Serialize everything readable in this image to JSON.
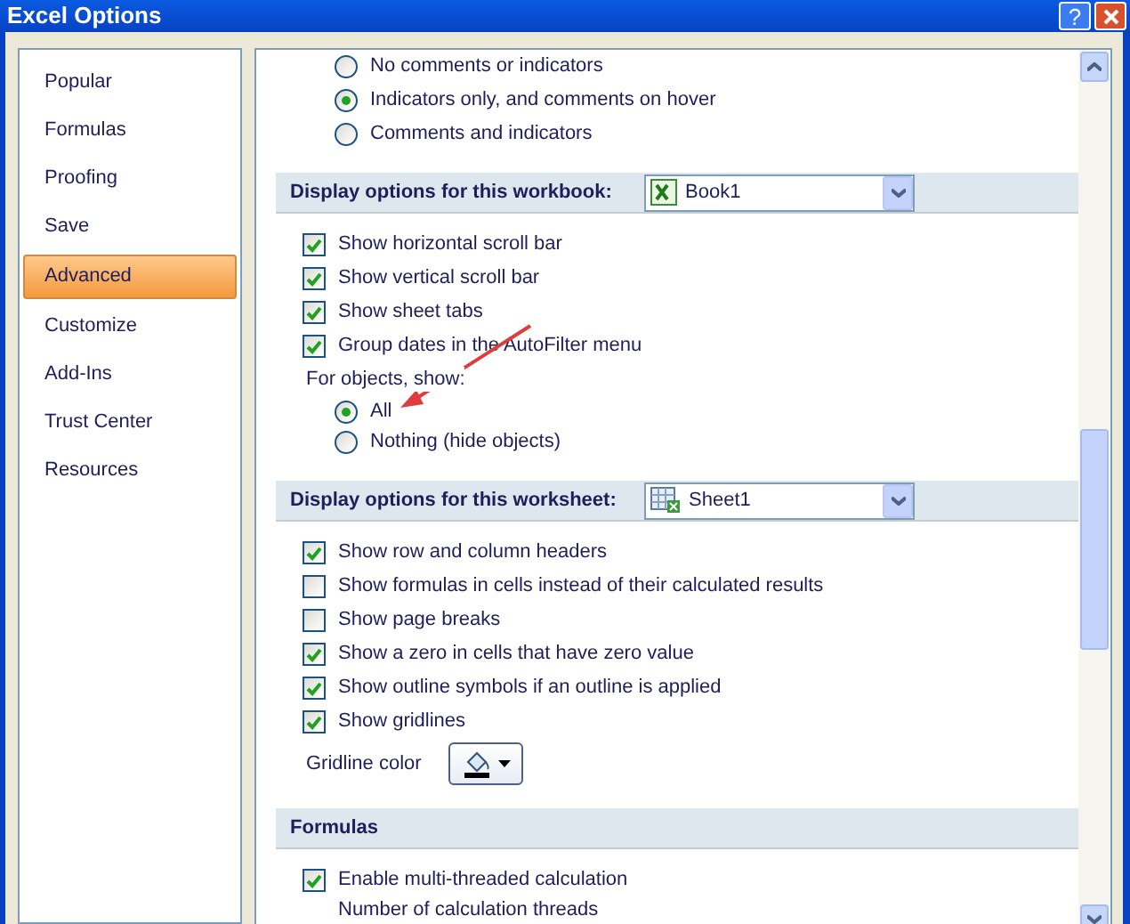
{
  "window": {
    "title": "Excel Options",
    "help_button": "?"
  },
  "nav": [
    {
      "label": "Popular",
      "selected": false
    },
    {
      "label": "Formulas",
      "selected": false
    },
    {
      "label": "Proofing",
      "selected": false
    },
    {
      "label": "Save",
      "selected": false
    },
    {
      "label": "Advanced",
      "selected": true
    },
    {
      "label": "Customize",
      "selected": false
    },
    {
      "label": "Add-Ins",
      "selected": false
    },
    {
      "label": "Trust Center",
      "selected": false
    },
    {
      "label": "Resources",
      "selected": false
    }
  ],
  "content": [
    {
      "kind": "radio",
      "label": "No comments or indicators",
      "selected": false
    },
    {
      "kind": "radio",
      "label": "Indicators only, and comments on hover",
      "selected": true
    },
    {
      "kind": "radio",
      "label": "Comments and indicators",
      "selected": false
    },
    {
      "kind": "section",
      "title": "Display options for this workbook:",
      "dropdown": {
        "value": "Book1"
      }
    },
    {
      "kind": "checkbox",
      "label": "Show horizontal scroll bar",
      "checked": true
    },
    {
      "kind": "checkbox",
      "label": "Show vertical scroll bar",
      "checked": true
    },
    {
      "kind": "checkbox",
      "label": "Show sheet tabs",
      "checked": true
    },
    {
      "kind": "checkbox",
      "label": "Group dates in the AutoFilter menu",
      "checked": true
    },
    {
      "kind": "label",
      "text": "For objects, show:"
    },
    {
      "kind": "radio",
      "label": "All",
      "selected": true
    },
    {
      "kind": "radio",
      "label": "Nothing (hide objects)",
      "selected": false
    },
    {
      "kind": "section",
      "title": "Display options for this worksheet:",
      "dropdown": {
        "value": "Sheet1"
      }
    },
    {
      "kind": "checkbox",
      "label": "Show row and column headers",
      "checked": true
    },
    {
      "kind": "checkbox",
      "label": "Show formulas in cells instead of their calculated results",
      "checked": false
    },
    {
      "kind": "checkbox",
      "label": "Show page breaks",
      "checked": false
    },
    {
      "kind": "checkbox",
      "label": "Show a zero in cells that have zero value",
      "checked": true
    },
    {
      "kind": "checkbox",
      "label": "Show outline symbols if an outline is applied",
      "checked": true
    },
    {
      "kind": "checkbox",
      "label": "Show gridlines",
      "checked": true
    },
    {
      "kind": "color_picker",
      "label": "Gridline color"
    },
    {
      "kind": "section",
      "title": "Formulas"
    },
    {
      "kind": "checkbox",
      "label": "Enable multi-threaded calculation",
      "checked": true
    },
    {
      "kind": "text",
      "text": "Number of calculation threads"
    }
  ]
}
